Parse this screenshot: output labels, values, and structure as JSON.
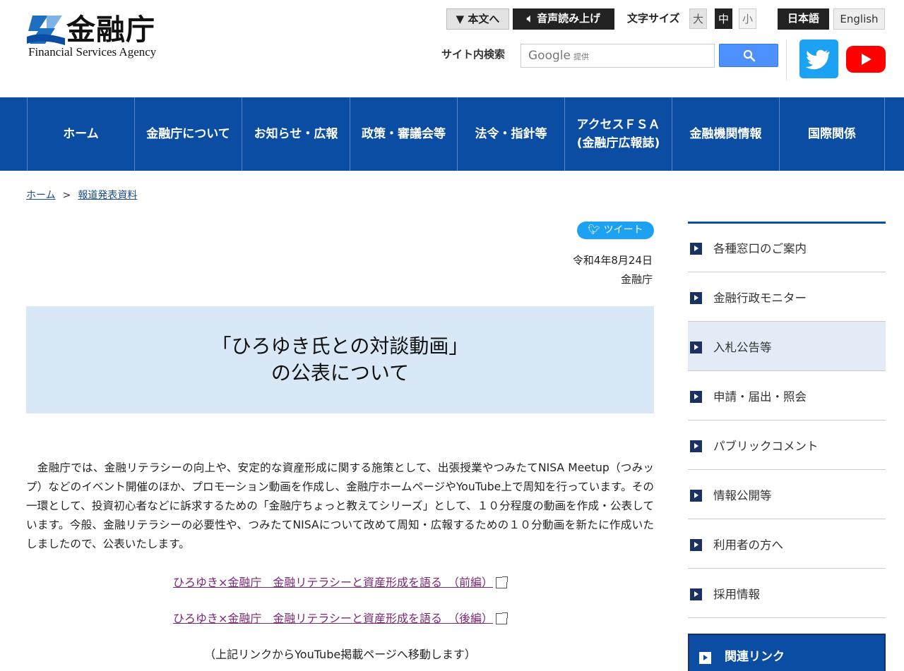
{
  "header": {
    "logo_jp": "金融庁",
    "logo_en": "Financial Services Agency",
    "skip_to_content": "▼ 本文へ",
    "read_aloud": "音声読み上げ",
    "font_size_label": "文字サイズ",
    "font_sizes": [
      "大",
      "中",
      "小"
    ],
    "lang_ja": "日本語",
    "lang_en": "English",
    "search_label": "サイト内検索",
    "search_placeholder_brand": "Google",
    "search_placeholder_suffix": "提供"
  },
  "nav": {
    "items": [
      {
        "label": "ホーム"
      },
      {
        "label": "金融庁について"
      },
      {
        "label": "お知らせ・広報"
      },
      {
        "label": "政策・審議会等"
      },
      {
        "label": "法令・指針等"
      },
      {
        "label": "アクセスＦＳＡ\n(金融庁広報誌)"
      },
      {
        "label": "金融機関情報"
      },
      {
        "label": "国際関係"
      }
    ]
  },
  "breadcrumb": {
    "home": "ホーム",
    "separator": ">",
    "current": "報道発表資料"
  },
  "article": {
    "tweet_label": "ツイート",
    "date": "令和4年8月24日",
    "issuer": "金融庁",
    "title": "「ひろゆき氏との対談動画」\nの公表について",
    "body": "　金融庁では、金融リテラシーの向上や、安定的な資産形成に関する施策として、出張授業やつみたてNISA Meetup（つみップ）などのイベント開催のほか、プロモーション動画を作成し、金融庁ホームページやYouTube上で周知を行っています。その一環として、投資初心者などに訴求するための「金融庁ちょっと教えてシリーズ」として、１０分程度の動画を作成・公表しています。今般、金融リテラシーの必要性や、つみたてNISAについて改めて周知・広報するための１０分動画を新たに作成いたしましたので、公表いたします。",
    "link1": "ひろゆき×金融庁　金融リテラシーと資産形成を語る　（前編）",
    "link2": "ひろゆき×金融庁　金融リテラシーと資産形成を語る　（後編）",
    "note": "（上記リンクからYouTube掲載ページへ移動します）"
  },
  "sidebar": {
    "items": [
      {
        "label": "各種窓口のご案内"
      },
      {
        "label": "金融行政モニター"
      },
      {
        "label": "入札公告等"
      },
      {
        "label": "申請・届出・照会"
      },
      {
        "label": "パブリックコメント"
      },
      {
        "label": "情報公開等"
      },
      {
        "label": "利用者の方へ"
      },
      {
        "label": "採用情報"
      }
    ],
    "related_label": "関連リンク"
  },
  "colors": {
    "nav_bg": "#0b4da2",
    "title_bg": "#d9e8f6",
    "link": "#7a2873",
    "twitter": "#1da1f2",
    "youtube": "#ff0000"
  }
}
